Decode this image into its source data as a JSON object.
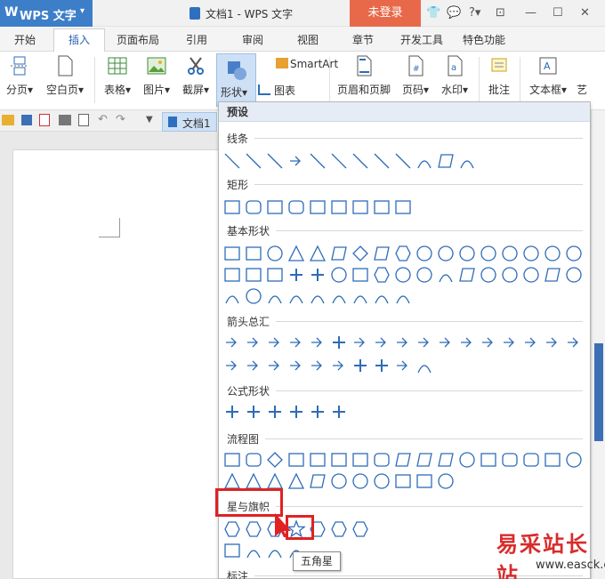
{
  "app": {
    "logo": "W",
    "name": "WPS 文字",
    "menu_arrow": "▾"
  },
  "window": {
    "title": "文档1 - WPS 文字",
    "login_label": "未登录",
    "help": "?",
    "minimize": "—",
    "close": "✕"
  },
  "tabs": [
    "开始",
    "插入",
    "页面布局",
    "引用",
    "审阅",
    "视图",
    "章节",
    "开发工具",
    "特色功能"
  ],
  "ribbon": {
    "page_break": "分页",
    "blank_page": "空白页",
    "table": "表格",
    "picture": "图片",
    "screenshot": "截屏",
    "shape": "形状",
    "smartart": "SmartArt",
    "chart": "图表",
    "header_footer": "页眉和页脚",
    "page_number": "页码",
    "watermark": "水印",
    "comment": "批注",
    "textbox": "文本框",
    "art": "艺"
  },
  "doc_tab": "文档1",
  "dropdown": {
    "title": "预设",
    "sections": [
      "线条",
      "矩形",
      "基本形状",
      "箭头总汇",
      "公式形状",
      "流程图",
      "星与旗帜",
      "标注"
    ]
  },
  "tooltip": "五角星",
  "watermark": {
    "text": "易采站长站",
    "url": "www.easck.com"
  },
  "colors": {
    "accent": "#3d7ec9",
    "login": "#e8694a",
    "highlight": "#e02222",
    "shape_stroke": "#2d6cb8"
  }
}
